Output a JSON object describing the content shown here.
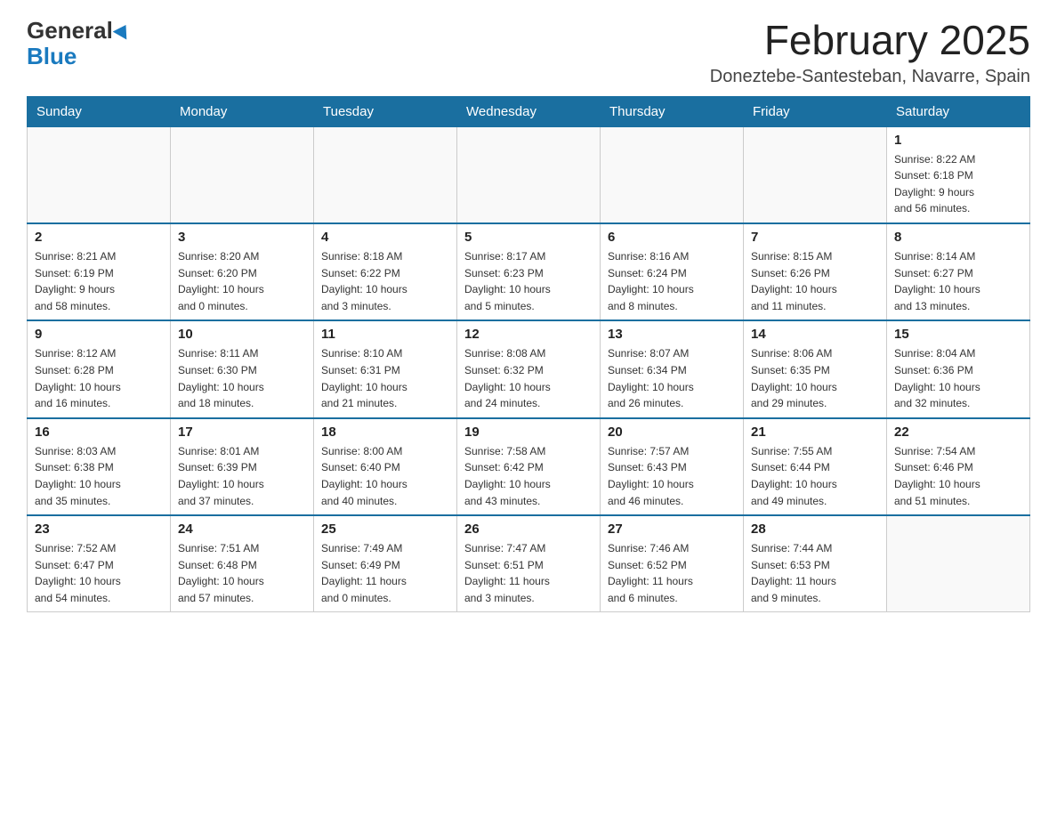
{
  "header": {
    "logo_general": "General",
    "logo_blue": "Blue",
    "month_title": "February 2025",
    "location": "Doneztebe-Santesteban, Navarre, Spain"
  },
  "days_of_week": [
    "Sunday",
    "Monday",
    "Tuesday",
    "Wednesday",
    "Thursday",
    "Friday",
    "Saturday"
  ],
  "weeks": [
    [
      {
        "num": "",
        "info": ""
      },
      {
        "num": "",
        "info": ""
      },
      {
        "num": "",
        "info": ""
      },
      {
        "num": "",
        "info": ""
      },
      {
        "num": "",
        "info": ""
      },
      {
        "num": "",
        "info": ""
      },
      {
        "num": "1",
        "info": "Sunrise: 8:22 AM\nSunset: 6:18 PM\nDaylight: 9 hours\nand 56 minutes."
      }
    ],
    [
      {
        "num": "2",
        "info": "Sunrise: 8:21 AM\nSunset: 6:19 PM\nDaylight: 9 hours\nand 58 minutes."
      },
      {
        "num": "3",
        "info": "Sunrise: 8:20 AM\nSunset: 6:20 PM\nDaylight: 10 hours\nand 0 minutes."
      },
      {
        "num": "4",
        "info": "Sunrise: 8:18 AM\nSunset: 6:22 PM\nDaylight: 10 hours\nand 3 minutes."
      },
      {
        "num": "5",
        "info": "Sunrise: 8:17 AM\nSunset: 6:23 PM\nDaylight: 10 hours\nand 5 minutes."
      },
      {
        "num": "6",
        "info": "Sunrise: 8:16 AM\nSunset: 6:24 PM\nDaylight: 10 hours\nand 8 minutes."
      },
      {
        "num": "7",
        "info": "Sunrise: 8:15 AM\nSunset: 6:26 PM\nDaylight: 10 hours\nand 11 minutes."
      },
      {
        "num": "8",
        "info": "Sunrise: 8:14 AM\nSunset: 6:27 PM\nDaylight: 10 hours\nand 13 minutes."
      }
    ],
    [
      {
        "num": "9",
        "info": "Sunrise: 8:12 AM\nSunset: 6:28 PM\nDaylight: 10 hours\nand 16 minutes."
      },
      {
        "num": "10",
        "info": "Sunrise: 8:11 AM\nSunset: 6:30 PM\nDaylight: 10 hours\nand 18 minutes."
      },
      {
        "num": "11",
        "info": "Sunrise: 8:10 AM\nSunset: 6:31 PM\nDaylight: 10 hours\nand 21 minutes."
      },
      {
        "num": "12",
        "info": "Sunrise: 8:08 AM\nSunset: 6:32 PM\nDaylight: 10 hours\nand 24 minutes."
      },
      {
        "num": "13",
        "info": "Sunrise: 8:07 AM\nSunset: 6:34 PM\nDaylight: 10 hours\nand 26 minutes."
      },
      {
        "num": "14",
        "info": "Sunrise: 8:06 AM\nSunset: 6:35 PM\nDaylight: 10 hours\nand 29 minutes."
      },
      {
        "num": "15",
        "info": "Sunrise: 8:04 AM\nSunset: 6:36 PM\nDaylight: 10 hours\nand 32 minutes."
      }
    ],
    [
      {
        "num": "16",
        "info": "Sunrise: 8:03 AM\nSunset: 6:38 PM\nDaylight: 10 hours\nand 35 minutes."
      },
      {
        "num": "17",
        "info": "Sunrise: 8:01 AM\nSunset: 6:39 PM\nDaylight: 10 hours\nand 37 minutes."
      },
      {
        "num": "18",
        "info": "Sunrise: 8:00 AM\nSunset: 6:40 PM\nDaylight: 10 hours\nand 40 minutes."
      },
      {
        "num": "19",
        "info": "Sunrise: 7:58 AM\nSunset: 6:42 PM\nDaylight: 10 hours\nand 43 minutes."
      },
      {
        "num": "20",
        "info": "Sunrise: 7:57 AM\nSunset: 6:43 PM\nDaylight: 10 hours\nand 46 minutes."
      },
      {
        "num": "21",
        "info": "Sunrise: 7:55 AM\nSunset: 6:44 PM\nDaylight: 10 hours\nand 49 minutes."
      },
      {
        "num": "22",
        "info": "Sunrise: 7:54 AM\nSunset: 6:46 PM\nDaylight: 10 hours\nand 51 minutes."
      }
    ],
    [
      {
        "num": "23",
        "info": "Sunrise: 7:52 AM\nSunset: 6:47 PM\nDaylight: 10 hours\nand 54 minutes."
      },
      {
        "num": "24",
        "info": "Sunrise: 7:51 AM\nSunset: 6:48 PM\nDaylight: 10 hours\nand 57 minutes."
      },
      {
        "num": "25",
        "info": "Sunrise: 7:49 AM\nSunset: 6:49 PM\nDaylight: 11 hours\nand 0 minutes."
      },
      {
        "num": "26",
        "info": "Sunrise: 7:47 AM\nSunset: 6:51 PM\nDaylight: 11 hours\nand 3 minutes."
      },
      {
        "num": "27",
        "info": "Sunrise: 7:46 AM\nSunset: 6:52 PM\nDaylight: 11 hours\nand 6 minutes."
      },
      {
        "num": "28",
        "info": "Sunrise: 7:44 AM\nSunset: 6:53 PM\nDaylight: 11 hours\nand 9 minutes."
      },
      {
        "num": "",
        "info": ""
      }
    ]
  ]
}
